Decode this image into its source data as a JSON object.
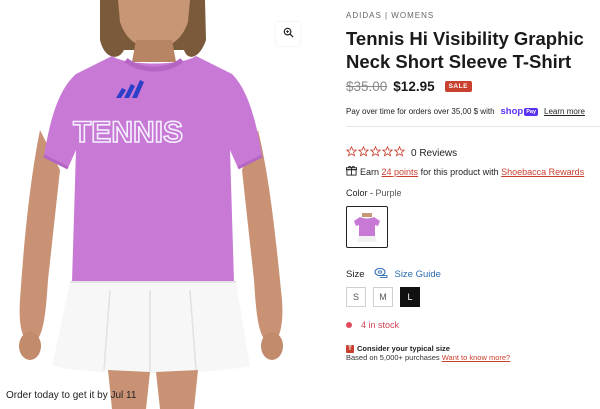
{
  "product": {
    "vendor": "ADIDAS | WOMENS",
    "title_line1": "Tennis Hi Visibility Graphic",
    "title_line2": "Neck Short Sleeve T-Shirt",
    "compare_price": "$35.00",
    "sale_price": "$12.95",
    "sale_badge": "SALE",
    "image_alt": "Purple Tennis graphic t-shirt",
    "shirt_print": "TENNIS"
  },
  "payment": {
    "text": "Pay over time for orders over 35,00 $ with",
    "shop_word": "shop",
    "pay_pill": "Pay",
    "learn_more": "Learn more"
  },
  "reviews": {
    "count_text": "0 Reviews",
    "rating": 0,
    "max_rating": 5
  },
  "points": {
    "prefix": "Earn",
    "points_link": "24 points",
    "middle": "for this product with",
    "program_link": "Shoebacca Rewards"
  },
  "color": {
    "label": "Color",
    "separator": "-",
    "selected": "Purple"
  },
  "size": {
    "label": "Size",
    "guide_label": "Size Guide",
    "options": [
      "S",
      "M",
      "L"
    ],
    "selected": "L"
  },
  "stock": {
    "text": "4 in stock"
  },
  "fit": {
    "badge": "T",
    "title": "Consider your typical size",
    "subtitle": "Based on 5,000+ purchases",
    "link": "Want to know more?"
  },
  "delivery": {
    "text": "Order today to get it by Jul 11"
  },
  "colors": {
    "sale_red": "#c9402f",
    "shop_purple": "#5a31f4",
    "stock_red": "#e24b5e",
    "shirt_purple": "#c879d6",
    "link_blue": "#2b6cb0"
  },
  "icons": {
    "zoom": "zoom-in-icon",
    "star": "star-outline-icon",
    "gift": "gift-icon",
    "size_guide": "ruler-icon"
  }
}
